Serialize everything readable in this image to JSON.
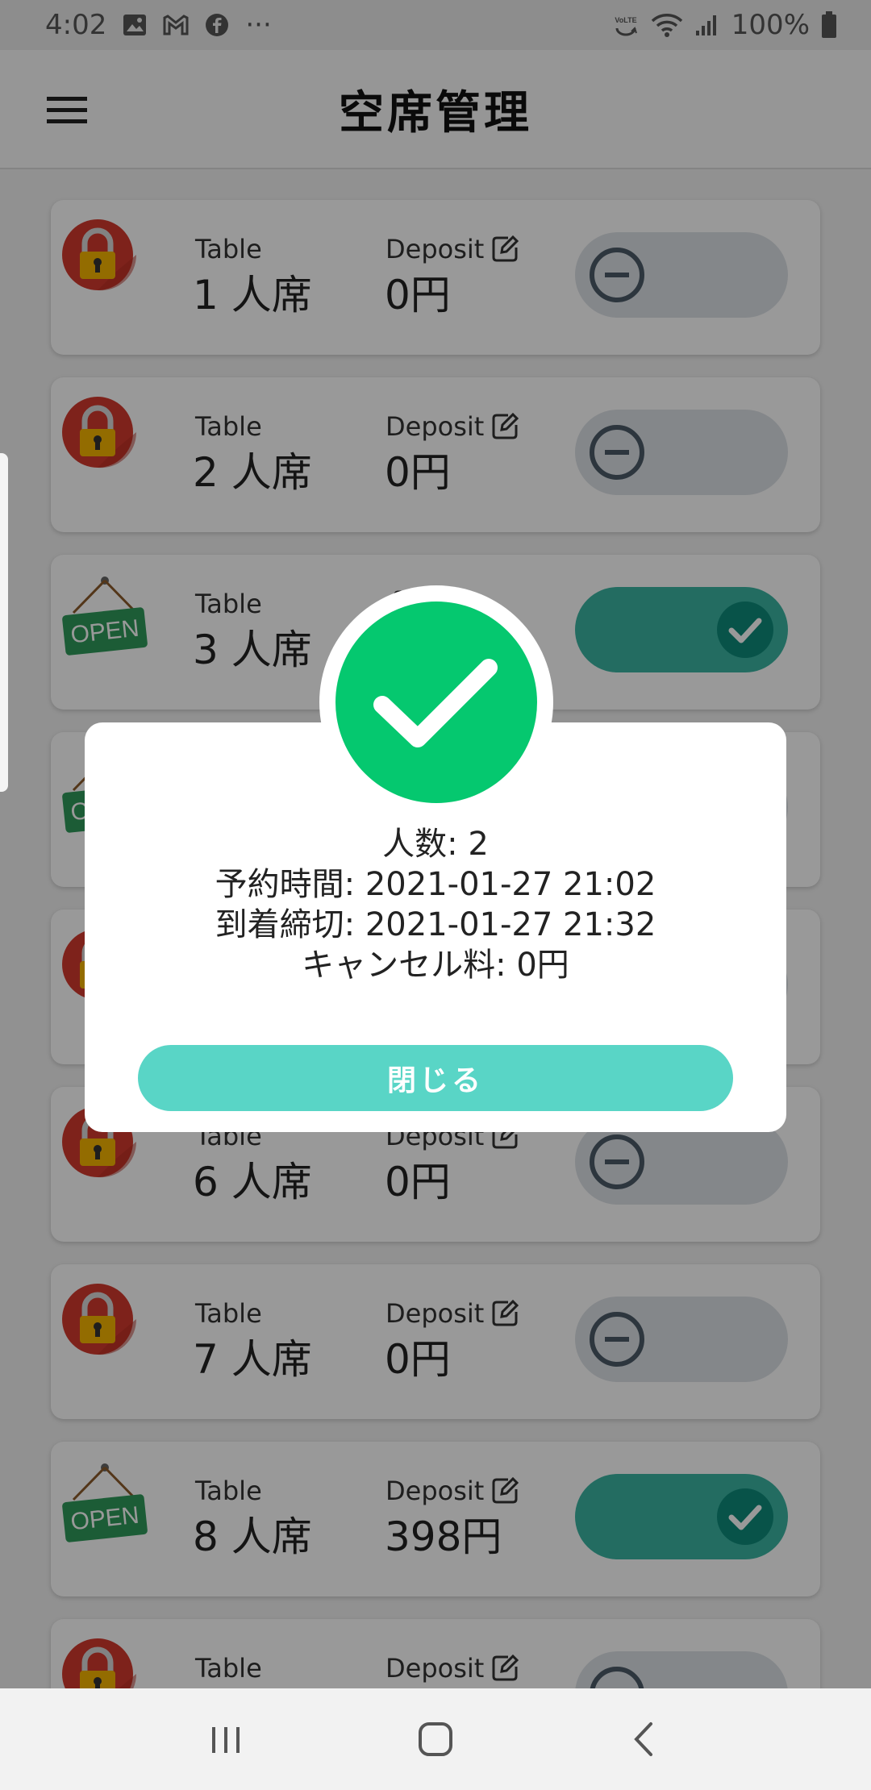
{
  "status_bar": {
    "time": "4:02",
    "battery": "100%",
    "dots": "···",
    "left_icons": [
      "image-icon",
      "gmail-icon",
      "facebook-icon"
    ],
    "right_icons": [
      "volte-icon",
      "wifi-icon",
      "signal-icon",
      "battery-icon"
    ]
  },
  "app_bar": {
    "title": "空席管理",
    "menu_icon": "hamburger-menu-icon"
  },
  "tables": [
    {
      "table_label": "Table",
      "table_value": "1 人席",
      "deposit_label": "Deposit",
      "deposit_value": "0円",
      "status": "locked",
      "toggle": "off"
    },
    {
      "table_label": "Table",
      "table_value": "2 人席",
      "deposit_label": "Deposit",
      "deposit_value": "0円",
      "status": "locked",
      "toggle": "off"
    },
    {
      "table_label": "Table",
      "table_value": "3 人席",
      "deposit_label": "",
      "deposit_value": "",
      "status": "open",
      "toggle": "on"
    },
    {
      "table_label": "",
      "table_value": "",
      "deposit_label": "",
      "deposit_value": "",
      "status": "open",
      "toggle": "off"
    },
    {
      "table_label": "",
      "table_value": "",
      "deposit_label": "",
      "deposit_value": "",
      "status": "locked",
      "toggle": "off"
    },
    {
      "table_label": "Table",
      "table_value": "6 人席",
      "deposit_label": "Deposit",
      "deposit_value": "0円",
      "status": "locked",
      "toggle": "off"
    },
    {
      "table_label": "Table",
      "table_value": "7 人席",
      "deposit_label": "Deposit",
      "deposit_value": "0円",
      "status": "locked",
      "toggle": "off"
    },
    {
      "table_label": "Table",
      "table_value": "8 人席",
      "deposit_label": "Deposit",
      "deposit_value": "398円",
      "status": "open",
      "toggle": "on"
    },
    {
      "table_label": "Table",
      "table_value": "",
      "deposit_label": "Deposit",
      "deposit_value": "",
      "status": "locked",
      "toggle": "off"
    }
  ],
  "open_sign_text": "OPEN",
  "dialog": {
    "icon": "success-check-icon",
    "lines": [
      "人数: 2",
      "予約時間: 2021-01-27 21:02",
      "到着締切: 2021-01-27 21:32",
      "キャンセル料: 0円"
    ],
    "close_label": "閉じる"
  },
  "colors": {
    "success_green": "#05c86f",
    "close_button": "#59d5c6",
    "toggle_on": "#3bb4a2",
    "lock_red": "#d23a2e",
    "open_sign_green": "#2f9a5a"
  },
  "nav_bar": {
    "icons": [
      "recent-apps-icon",
      "home-icon",
      "back-icon"
    ]
  }
}
